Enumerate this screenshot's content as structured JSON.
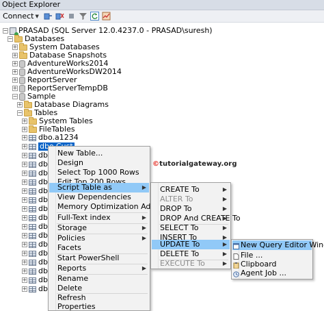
{
  "window": {
    "title": "Object Explorer"
  },
  "toolbar": {
    "connect_label": "Connect"
  },
  "tree": {
    "server": "PRASAD (SQL Server 12.0.4237.0 - PRASAD\\suresh)",
    "databases": "Databases",
    "system_databases": "System Databases",
    "database_snapshots": "Database Snapshots",
    "db1": "AdventureWorks2014",
    "db2": "AdventureWorksDW2014",
    "db3": "ReportServer",
    "db4": "ReportServerTempDB",
    "db5": "Sample",
    "database_diagrams": "Database Diagrams",
    "tables": "Tables",
    "system_tables": "System Tables",
    "file_tables": "FileTables",
    "table_a1234": "dbo.a1234",
    "selected_table": "dbo.Cust",
    "rows": [
      "dbo.Cu",
      "dbo.Cu",
      "dbo.Cu",
      "dbo.Cu",
      "dbo.Cu",
      "dbo.De",
      "dbo.De",
      "dbo.De",
      "dbo.De",
      "dbo.De",
      "dbo.De",
      "dbo.Di",
      "dbo.Di",
      "dbo.Di",
      "dbo.Di",
      "dbo.Di"
    ]
  },
  "context_menu": {
    "items": [
      "New Table...",
      "Design",
      "Select Top 1000 Rows",
      "Edit Top 200 Rows",
      "Script Table as",
      "View Dependencies",
      "Memory Optimization Advisor",
      "Full-Text index",
      "Storage",
      "Policies",
      "Facets",
      "Start PowerShell",
      "Reports",
      "Rename",
      "Delete",
      "Refresh",
      "Properties"
    ]
  },
  "script_menu": {
    "items": [
      "CREATE To",
      "ALTER To",
      "DROP To",
      "DROP And CREATE To",
      "SELECT To",
      "INSERT To",
      "UPDATE To",
      "DELETE To",
      "EXECUTE To"
    ]
  },
  "update_menu": {
    "items": [
      "New Query Editor Window",
      "File ...",
      "Clipboard",
      "Agent Job ..."
    ]
  },
  "watermark": {
    "prefix": "©",
    "text": "tutorialgateway.org"
  }
}
